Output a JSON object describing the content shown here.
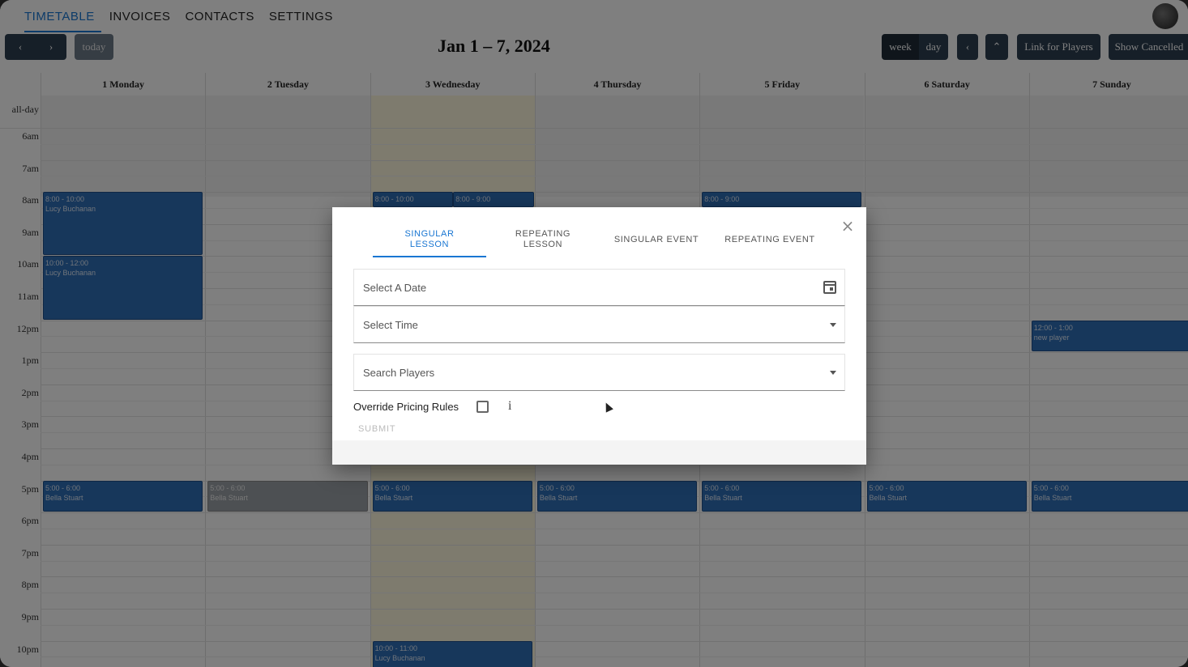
{
  "nav": {
    "tabs": [
      {
        "label": "TIMETABLE",
        "active": true
      },
      {
        "label": "INVOICES",
        "active": false
      },
      {
        "label": "CONTACTS",
        "active": false
      },
      {
        "label": "SETTINGS",
        "active": false
      }
    ],
    "avatar_icon": "user-avatar"
  },
  "toolbar": {
    "prev_icon": "‹",
    "next_icon": "›",
    "today_label": "today",
    "range_title": "Jan 1 – 7, 2024",
    "week_label": "week",
    "day_label": "day",
    "btn_a_label": "‹",
    "btn_b_label": "⌃",
    "link_label": "Link for Players",
    "show_label": "Show Cancelled"
  },
  "calendar": {
    "all_day_label": "all-day",
    "days": [
      "1 Monday",
      "2 Tuesday",
      "3 Wednesday",
      "4 Thursday",
      "5 Friday",
      "6 Saturday",
      "7 Sunday"
    ],
    "today_index": 2,
    "hours": [
      "6am",
      "7am",
      "8am",
      "9am",
      "10am",
      "11am",
      "12pm",
      "1pm",
      "2pm",
      "3pm",
      "4pm",
      "5pm",
      "6pm",
      "7pm",
      "8pm",
      "9pm",
      "10pm"
    ],
    "events": [
      {
        "day": 0,
        "start": 8,
        "end": 10,
        "time": "8:00 - 10:00",
        "title": "Lucy Buchanan",
        "past": false
      },
      {
        "day": 0,
        "start": 10,
        "end": 12,
        "time": "10:00 - 12:00",
        "title": "Lucy Buchanan",
        "past": false
      },
      {
        "day": 2,
        "start": 8,
        "end": 8.5,
        "time": "8:00 - 10:00",
        "title": "",
        "past": false
      },
      {
        "day": 2.5,
        "start": 8,
        "end": 8.5,
        "time": "8:00 - 9:00",
        "title": "",
        "past": false
      },
      {
        "day": 4,
        "start": 8,
        "end": 8.5,
        "time": "8:00 - 9:00",
        "title": "",
        "past": false
      },
      {
        "day": 6,
        "start": 12,
        "end": 13,
        "time": "12:00 - 1:00",
        "title": "new player",
        "past": false
      },
      {
        "day": 0,
        "start": 17,
        "end": 18,
        "time": "5:00 - 6:00",
        "title": "Bella Stuart",
        "past": false
      },
      {
        "day": 1,
        "start": 17,
        "end": 18,
        "time": "5:00 - 6:00",
        "title": "Bella Stuart",
        "past": true
      },
      {
        "day": 2,
        "start": 17,
        "end": 18,
        "time": "5:00 - 6:00",
        "title": "Bella Stuart",
        "past": false
      },
      {
        "day": 3,
        "start": 17,
        "end": 18,
        "time": "5:00 - 6:00",
        "title": "Bella Stuart",
        "past": false
      },
      {
        "day": 4,
        "start": 17,
        "end": 18,
        "time": "5:00 - 6:00",
        "title": "Bella Stuart",
        "past": false
      },
      {
        "day": 5,
        "start": 17,
        "end": 18,
        "time": "5:00 - 6:00",
        "title": "Bella Stuart",
        "past": false
      },
      {
        "day": 6,
        "start": 17,
        "end": 18,
        "time": "5:00 - 6:00",
        "title": "Bella Stuart",
        "past": false
      },
      {
        "day": 2,
        "start": 22,
        "end": 23,
        "time": "10:00 - 11:00",
        "title": "Lucy Buchanan",
        "past": false
      }
    ]
  },
  "dialog": {
    "tabs": [
      {
        "label": "SINGULAR LESSON",
        "active": true
      },
      {
        "label": "REPEATING LESSON",
        "active": false
      },
      {
        "label": "SINGULAR EVENT",
        "active": false
      },
      {
        "label": "REPEATING EVENT",
        "active": false
      }
    ],
    "close_icon": "×",
    "date_placeholder": "Select A Date",
    "time_placeholder": "Select Time",
    "players_placeholder": "Search Players",
    "override_label": "Override Pricing Rules",
    "info_icon": "i",
    "submit_label": "SUBMIT"
  }
}
